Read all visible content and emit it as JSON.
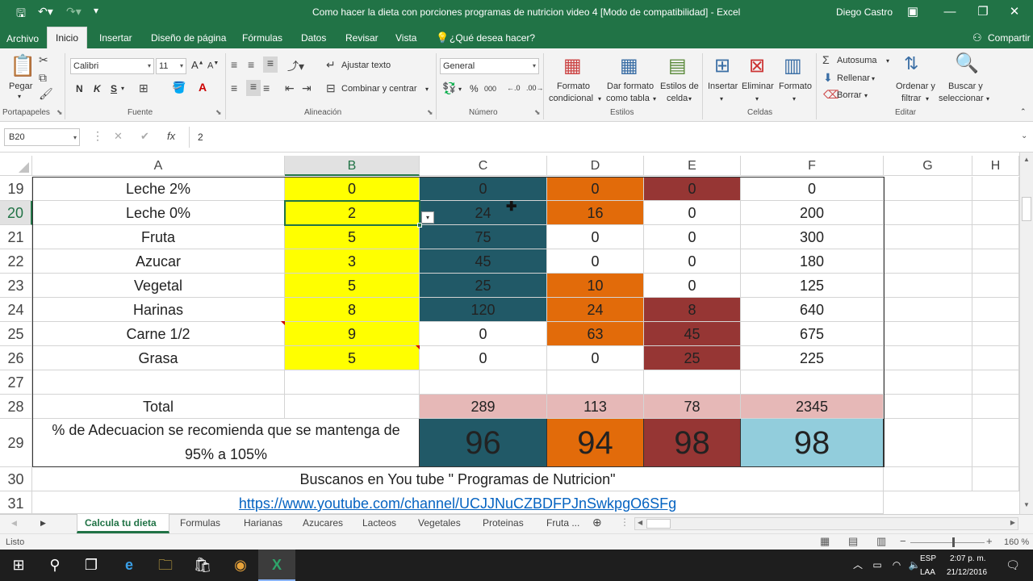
{
  "window": {
    "title": "Como hacer la dieta con porciones programas de nutricion video 4  [Modo de compatibilidad]  -  Excel",
    "user": "Diego Castro",
    "qat_more": "▾"
  },
  "menu": {
    "tabs": [
      "Archivo",
      "Inicio",
      "Insertar",
      "Diseño de página",
      "Fórmulas",
      "Datos",
      "Revisar",
      "Vista"
    ],
    "tell_me": "¿Qué desea hacer?",
    "share": "Compartir"
  },
  "ribbon": {
    "paste_label": "Pegar",
    "font_name": "Calibri",
    "font_size": "11",
    "bold": "N",
    "italic": "K",
    "underline": "S",
    "wrap_text": "Ajustar texto",
    "merge_center": "Combinar y centrar",
    "number_format": "General",
    "percent": "%",
    "thousands": "000",
    "cond_format_1": "Formato",
    "cond_format_2": "condicional",
    "table_format_1": "Dar formato",
    "table_format_2": "como tabla",
    "cell_styles_1": "Estilos de",
    "cell_styles_2": "celda",
    "insert": "Insertar",
    "delete": "Eliminar",
    "format": "Formato",
    "autosum": "Autosuma",
    "fill": "Rellenar",
    "clear": "Borrar",
    "sort_1": "Ordenar y",
    "sort_2": "filtrar",
    "find_1": "Buscar y",
    "find_2": "seleccionar",
    "groups": {
      "clipboard": "Portapapeles",
      "font": "Fuente",
      "alignment": "Alineación",
      "number": "Número",
      "styles": "Estilos",
      "cells": "Celdas",
      "editing": "Editar"
    }
  },
  "formula_bar": {
    "name_box": "B20",
    "fx": "fx",
    "value": "2"
  },
  "columns": [
    "A",
    "B",
    "C",
    "D",
    "E",
    "F",
    "G",
    "H"
  ],
  "rows": [
    {
      "num": "19",
      "a": "Leche 2%",
      "b": "0",
      "c": "0",
      "d": "0",
      "e": "0",
      "f": "0"
    },
    {
      "num": "20",
      "a": "Leche 0%",
      "b": "2",
      "c": "24",
      "d": "16",
      "e": "0",
      "f": "200"
    },
    {
      "num": "21",
      "a": "Fruta",
      "b": "5",
      "c": "75",
      "d": "0",
      "e": "0",
      "f": "300"
    },
    {
      "num": "22",
      "a": "Azucar",
      "b": "3",
      "c": "45",
      "d": "0",
      "e": "0",
      "f": "180"
    },
    {
      "num": "23",
      "a": "Vegetal",
      "b": "5",
      "c": "25",
      "d": "10",
      "e": "0",
      "f": "125"
    },
    {
      "num": "24",
      "a": "Harinas",
      "b": "8",
      "c": "120",
      "d": "24",
      "e": "8",
      "f": "640"
    },
    {
      "num": "25",
      "a": "Carne 1/2",
      "b": "9",
      "c": "0",
      "d": "63",
      "e": "45",
      "f": "675"
    },
    {
      "num": "26",
      "a": "Grasa",
      "b": "5",
      "c": "0",
      "d": "0",
      "e": "25",
      "f": "225"
    }
  ],
  "row27": "27",
  "total_row": {
    "num": "28",
    "label": "Total",
    "c": "289",
    "d": "113",
    "e": "78",
    "f": "2345"
  },
  "adequacy_row": {
    "num": "29",
    "line1": "% de Adecuacion se recomienda que se mantenga de",
    "line2": "95% a 105%",
    "c": "96",
    "d": "94",
    "e": "98",
    "f": "98"
  },
  "row30": {
    "num": "30",
    "text": "Buscanos en You tube \" Programas de Nutricion\""
  },
  "row31": {
    "num": "31",
    "text": "https://www.youtube.com/channel/UCJJNuCZBDFPJnSwkpgO6SFg"
  },
  "sheets": [
    "Calcula tu dieta",
    "Formulas",
    "Harianas",
    "Azucares",
    "Lacteos",
    "Vegetales",
    "Proteinas",
    "Fruta ..."
  ],
  "status": {
    "ready": "Listo",
    "zoom": "160 %"
  },
  "taskbar": {
    "lang1": "ESP",
    "lang2": "LAA",
    "time": "2:07 p. m.",
    "date": "21/12/2016"
  },
  "colors": {
    "excel_green": "#217346",
    "teal": "#215967",
    "orange": "#e26b0a",
    "red": "#963634",
    "yellow": "#ffff00",
    "pink": "#e6b8b7",
    "light_blue": "#92cddc"
  }
}
